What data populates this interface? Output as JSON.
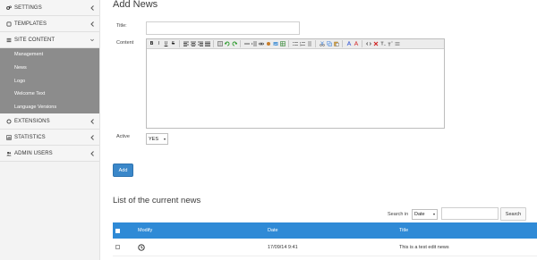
{
  "sidebar": {
    "items": [
      {
        "label": "SETTINGS",
        "icon": "gears-icon"
      },
      {
        "label": "TEMPLATES",
        "icon": "square-icon"
      },
      {
        "label": "SITE CONTENT",
        "icon": "list-icon"
      },
      {
        "label": "EXTENSIONS",
        "icon": "circle-icon"
      },
      {
        "label": "STATISTICS",
        "icon": "bar-chart-icon"
      },
      {
        "label": "ADMIN USERS",
        "icon": "users-icon"
      }
    ],
    "sub_items": [
      "Management",
      "News",
      "Logo",
      "Welcome Text",
      "Language Versions"
    ]
  },
  "form": {
    "heading": "Add News",
    "title_label": "Title:",
    "content_label": "Content",
    "active_label": "Active",
    "active_value": "YES",
    "add_button": "Add"
  },
  "list": {
    "heading": "List of the current news",
    "search_in_label": "Search in",
    "search_field": "Date",
    "search_button": "Search",
    "columns": {
      "modify": "Modify",
      "date": "Date",
      "title": "Title"
    },
    "rows": [
      {
        "date": "17/09/14 9:41",
        "title": "This is a test edit news"
      }
    ]
  },
  "colors": {
    "accent": "#3a87c9",
    "table_header": "#2f8ad6",
    "submenu_bg": "#8c8c8c",
    "sidebar_bg": "#f3f3f3"
  }
}
